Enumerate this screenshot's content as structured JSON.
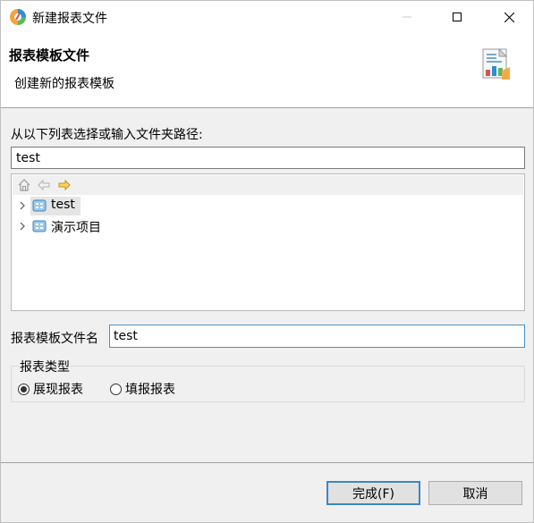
{
  "window": {
    "title": "新建报表文件",
    "minimize_glyph": "—",
    "maximize_glyph": "☐",
    "close_glyph": "✕"
  },
  "header": {
    "title": "报表模板文件",
    "description": "创建新的报表模板",
    "icon": "report-wizard-icon"
  },
  "folder": {
    "label": "从以下列表选择或输入文件夹路径:",
    "path_value": "test"
  },
  "tree": {
    "toolbar": [
      "home-icon",
      "back-icon",
      "forward-icon"
    ],
    "items": [
      {
        "label": "test",
        "selected": true,
        "icon": "project-icon"
      },
      {
        "label": "演示项目",
        "selected": false,
        "icon": "project-icon"
      }
    ]
  },
  "file_name": {
    "label": "报表模板文件名",
    "value": "test"
  },
  "report_type": {
    "legend": "报表类型",
    "options": [
      {
        "label": "展现报表",
        "checked": true
      },
      {
        "label": "填报报表",
        "checked": false
      }
    ]
  },
  "buttons": {
    "finish": "完成(F)",
    "cancel": "取消"
  },
  "colors": {
    "accent": "#3c86c8",
    "window_bg": "#f0f0f0",
    "header_bg": "#ffffff"
  }
}
